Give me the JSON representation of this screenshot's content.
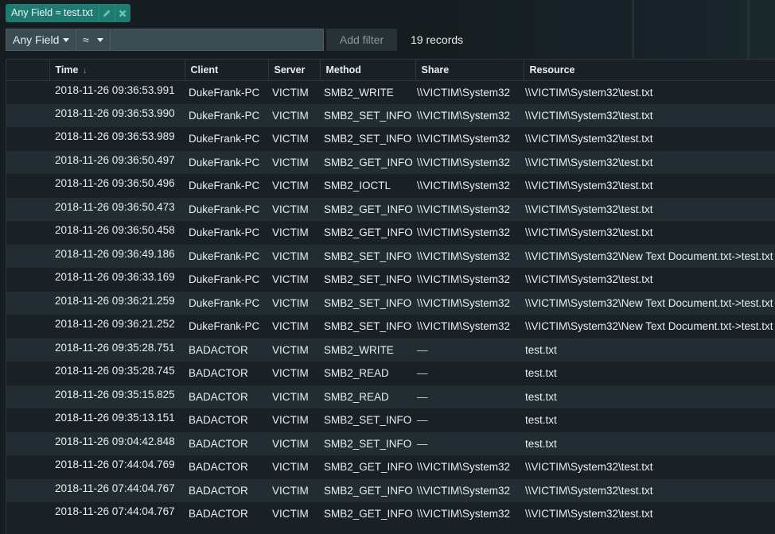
{
  "filter_chip": {
    "label": "Any Field ≈ test.txt",
    "edit_icon": "pencil-icon",
    "remove_icon": "close-icon"
  },
  "filter_bar": {
    "field_select": "Any Field",
    "operator_select": "≈",
    "value_input": "",
    "value_placeholder": "",
    "add_filter_label": "Add filter"
  },
  "records_count": "19 records",
  "table": {
    "columns": [
      {
        "key": "select",
        "label": ""
      },
      {
        "key": "time",
        "label": "Time",
        "sort": "desc",
        "sort_icon": "arrow-down-icon"
      },
      {
        "key": "client",
        "label": "Client"
      },
      {
        "key": "server",
        "label": "Server"
      },
      {
        "key": "method",
        "label": "Method"
      },
      {
        "key": "share",
        "label": "Share"
      },
      {
        "key": "resource",
        "label": "Resource"
      }
    ],
    "rows": [
      {
        "time": "2018-11-26 09:36:53.991",
        "client": "DukeFrank-PC",
        "server": "VICTIM",
        "method": "SMB2_WRITE",
        "share": "\\\\VICTIM\\System32",
        "resource": "\\\\VICTIM\\System32\\test.txt"
      },
      {
        "time": "2018-11-26 09:36:53.990",
        "client": "DukeFrank-PC",
        "server": "VICTIM",
        "method": "SMB2_SET_INFO",
        "share": "\\\\VICTIM\\System32",
        "resource": "\\\\VICTIM\\System32\\test.txt"
      },
      {
        "time": "2018-11-26 09:36:53.989",
        "client": "DukeFrank-PC",
        "server": "VICTIM",
        "method": "SMB2_SET_INFO",
        "share": "\\\\VICTIM\\System32",
        "resource": "\\\\VICTIM\\System32\\test.txt"
      },
      {
        "time": "2018-11-26 09:36:50.497",
        "client": "DukeFrank-PC",
        "server": "VICTIM",
        "method": "SMB2_GET_INFO",
        "share": "\\\\VICTIM\\System32",
        "resource": "\\\\VICTIM\\System32\\test.txt"
      },
      {
        "time": "2018-11-26 09:36:50.496",
        "client": "DukeFrank-PC",
        "server": "VICTIM",
        "method": "SMB2_IOCTL",
        "share": "\\\\VICTIM\\System32",
        "resource": "\\\\VICTIM\\System32\\test.txt"
      },
      {
        "time": "2018-11-26 09:36:50.473",
        "client": "DukeFrank-PC",
        "server": "VICTIM",
        "method": "SMB2_GET_INFO",
        "share": "\\\\VICTIM\\System32",
        "resource": "\\\\VICTIM\\System32\\test.txt"
      },
      {
        "time": "2018-11-26 09:36:50.458",
        "client": "DukeFrank-PC",
        "server": "VICTIM",
        "method": "SMB2_GET_INFO",
        "share": "\\\\VICTIM\\System32",
        "resource": "\\\\VICTIM\\System32\\test.txt"
      },
      {
        "time": "2018-11-26 09:36:49.186",
        "client": "DukeFrank-PC",
        "server": "VICTIM",
        "method": "SMB2_SET_INFO",
        "share": "\\\\VICTIM\\System32",
        "resource": "\\\\VICTIM\\System32\\New Text Document.txt->test.txt"
      },
      {
        "time": "2018-11-26 09:36:33.169",
        "client": "DukeFrank-PC",
        "server": "VICTIM",
        "method": "SMB2_SET_INFO",
        "share": "\\\\VICTIM\\System32",
        "resource": "\\\\VICTIM\\System32\\test.txt"
      },
      {
        "time": "2018-11-26 09:36:21.259",
        "client": "DukeFrank-PC",
        "server": "VICTIM",
        "method": "SMB2_SET_INFO",
        "share": "\\\\VICTIM\\System32",
        "resource": "\\\\VICTIM\\System32\\New Text Document.txt->test.txt"
      },
      {
        "time": "2018-11-26 09:36:21.252",
        "client": "DukeFrank-PC",
        "server": "VICTIM",
        "method": "SMB2_SET_INFO",
        "share": "\\\\VICTIM\\System32",
        "resource": "\\\\VICTIM\\System32\\New Text Document.txt->test.txt"
      },
      {
        "time": "2018-11-26 09:35:28.751",
        "client": "BADACTOR",
        "server": "VICTIM",
        "method": "SMB2_WRITE",
        "share": "—",
        "resource": "test.txt"
      },
      {
        "time": "2018-11-26 09:35:28.745",
        "client": "BADACTOR",
        "server": "VICTIM",
        "method": "SMB2_READ",
        "share": "—",
        "resource": "test.txt"
      },
      {
        "time": "2018-11-26 09:35:15.825",
        "client": "BADACTOR",
        "server": "VICTIM",
        "method": "SMB2_READ",
        "share": "—",
        "resource": "test.txt"
      },
      {
        "time": "2018-11-26 09:35:13.151",
        "client": "BADACTOR",
        "server": "VICTIM",
        "method": "SMB2_SET_INFO",
        "share": "—",
        "resource": "test.txt"
      },
      {
        "time": "2018-11-26 09:04:42.848",
        "client": "BADACTOR",
        "server": "VICTIM",
        "method": "SMB2_SET_INFO",
        "share": "—",
        "resource": "test.txt"
      },
      {
        "time": "2018-11-26 07:44:04.769",
        "client": "BADACTOR",
        "server": "VICTIM",
        "method": "SMB2_GET_INFO",
        "share": "\\\\VICTIM\\System32",
        "resource": "\\\\VICTIM\\System32\\test.txt"
      },
      {
        "time": "2018-11-26 07:44:04.767",
        "client": "BADACTOR",
        "server": "VICTIM",
        "method": "SMB2_GET_INFO",
        "share": "\\\\VICTIM\\System32",
        "resource": "\\\\VICTIM\\System32\\test.txt"
      },
      {
        "time": "2018-11-26 07:44:04.767",
        "client": "BADACTOR",
        "server": "VICTIM",
        "method": "SMB2_GET_INFO",
        "share": "\\\\VICTIM\\System32",
        "resource": "\\\\VICTIM\\System32\\test.txt"
      }
    ]
  },
  "colors": {
    "chip_bg": "#1f7a70",
    "chip_icon": "#5fc9b8",
    "input_bg": "#3a4b52",
    "row_odd": "#1a2126",
    "row_even": "#222d33",
    "text": "#e9eef0"
  }
}
